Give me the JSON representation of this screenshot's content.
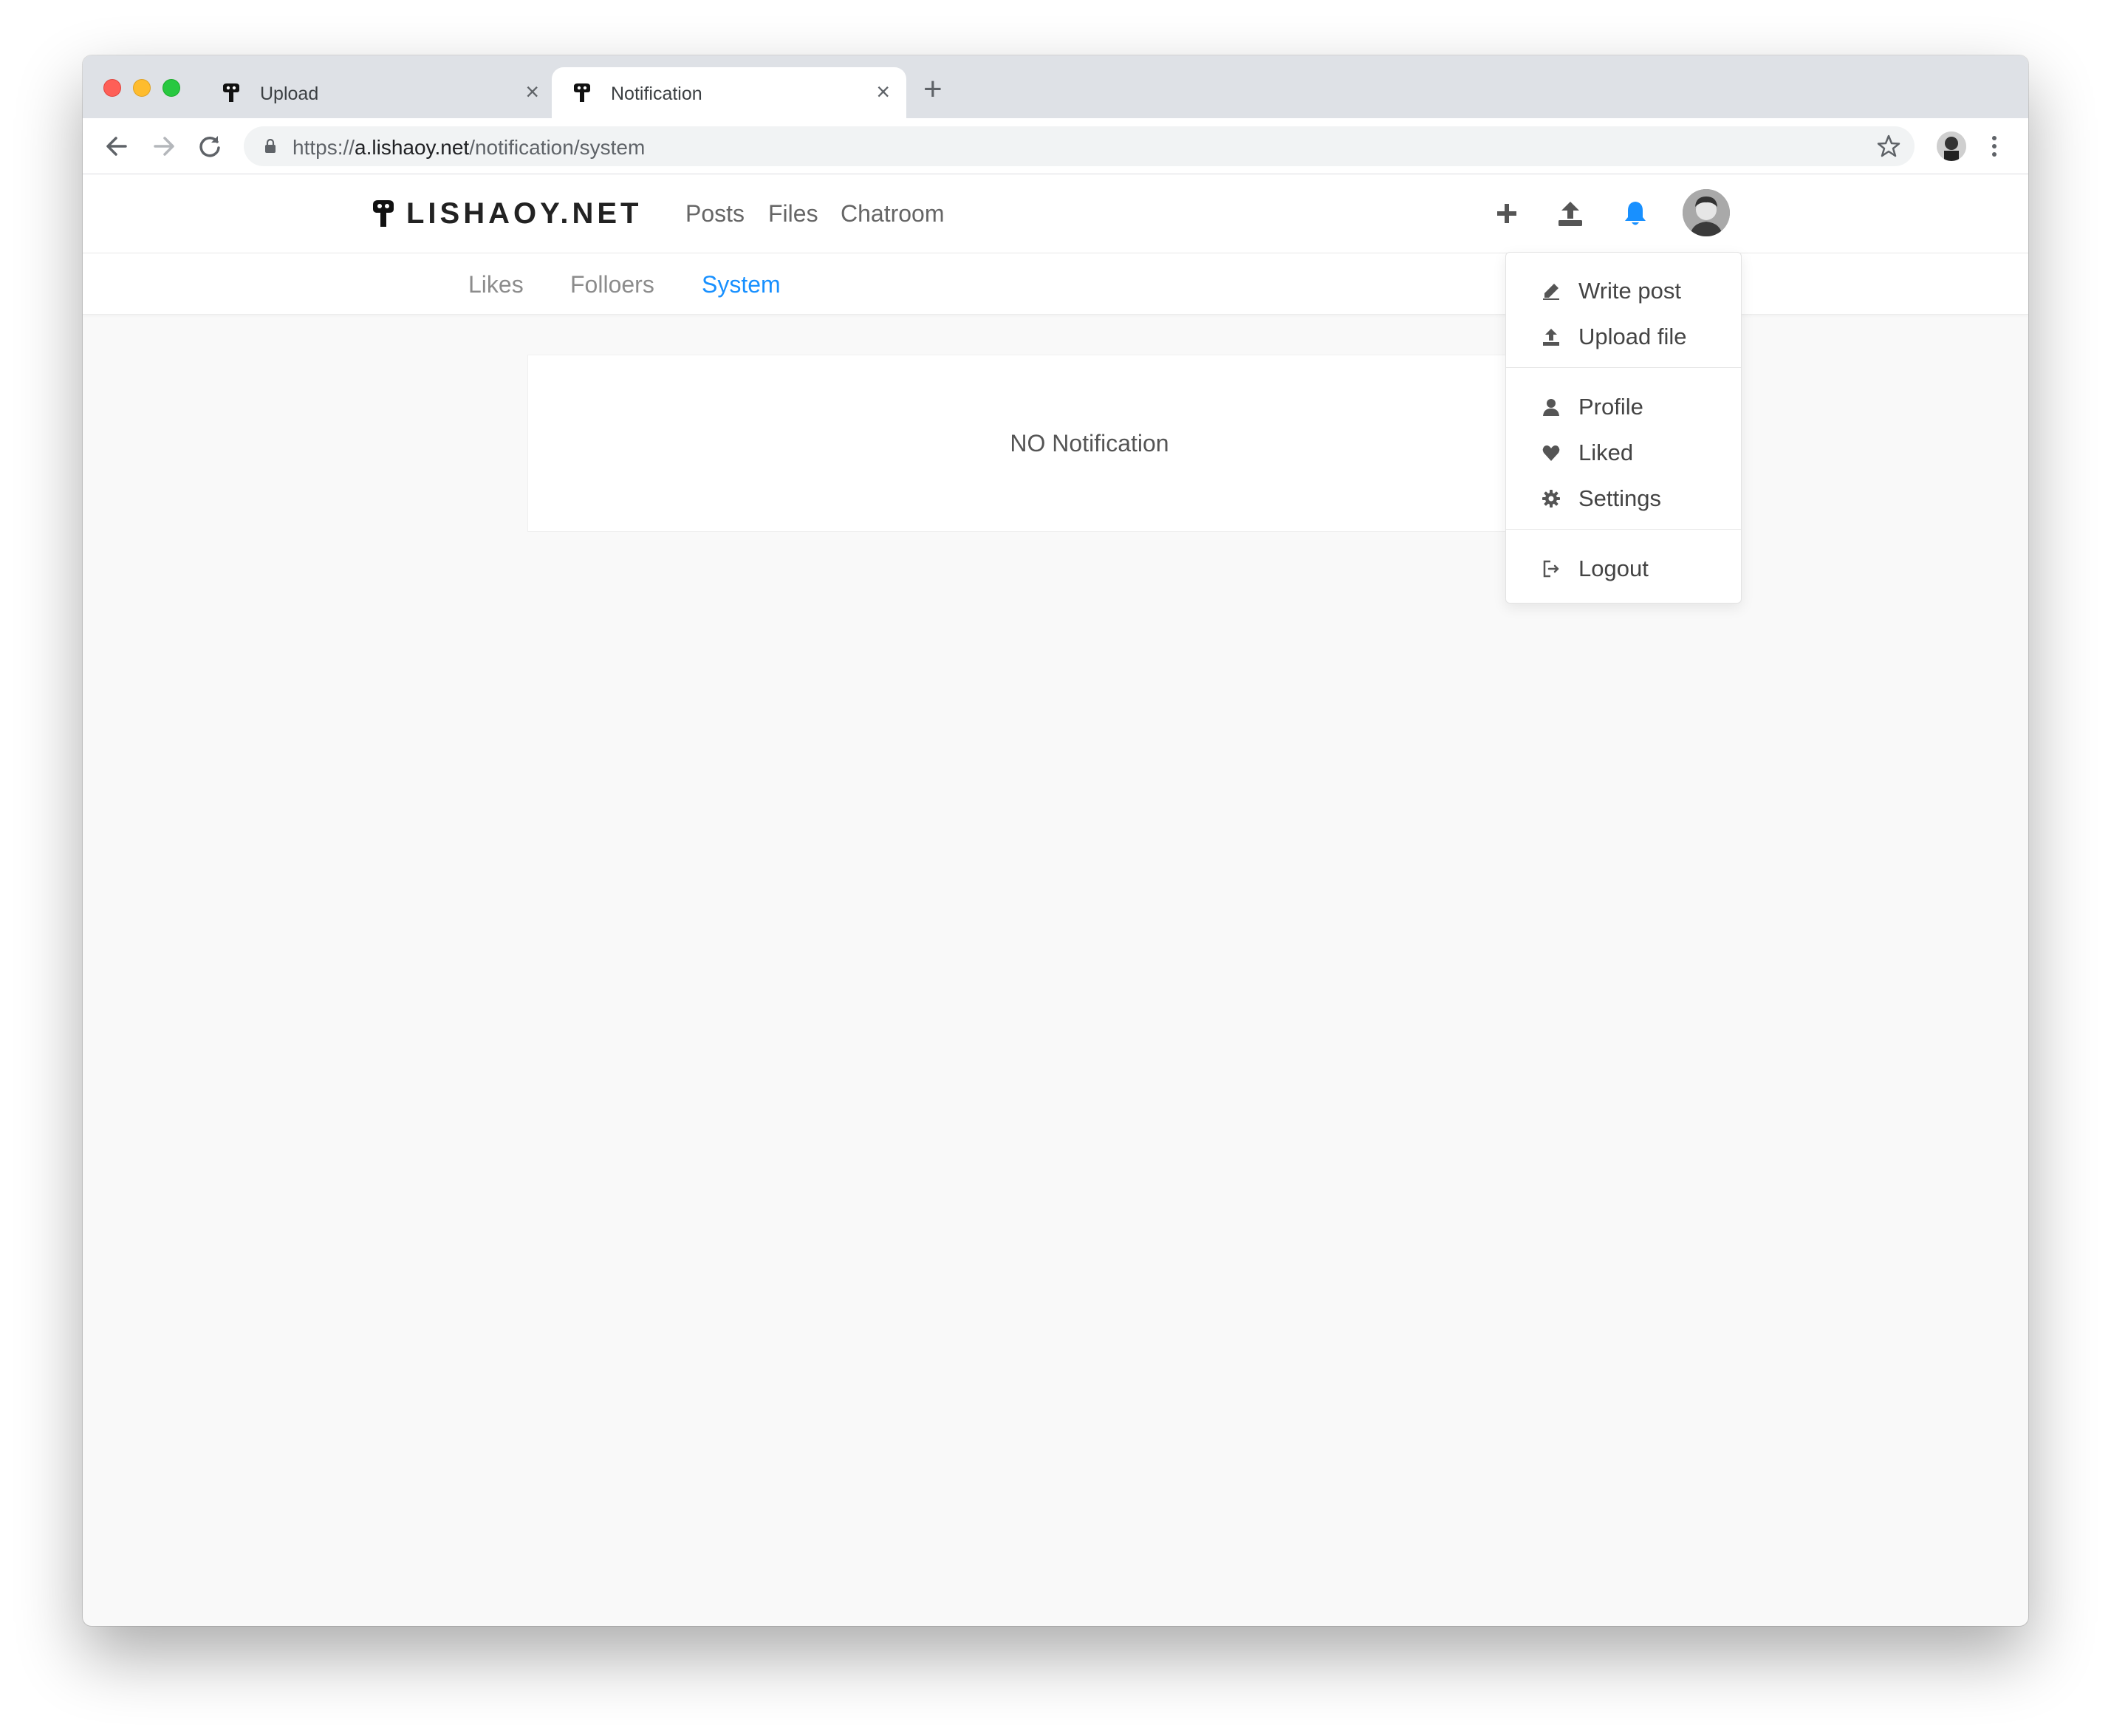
{
  "browser": {
    "tabs": [
      {
        "title": "Upload",
        "close": "×"
      },
      {
        "title": "Notification",
        "close": "×"
      }
    ],
    "new_tab": "+",
    "url_scheme": "https://",
    "url_host": "a.lishaoy.net",
    "url_path": "/notification/system"
  },
  "site": {
    "logo_text": "LISHAOY.NET",
    "nav": [
      "Posts",
      "Files",
      "Chatroom"
    ],
    "accent_color": "#1890ff"
  },
  "subnav": {
    "tabs": [
      "Likes",
      "Folloers",
      "System"
    ],
    "active": "System"
  },
  "main": {
    "empty_message": "NO Notification"
  },
  "user_menu": {
    "items": [
      {
        "label": "Write post",
        "icon": "pencil-icon"
      },
      {
        "label": "Upload file",
        "icon": "upload-icon"
      },
      {
        "label": "Profile",
        "icon": "user-icon"
      },
      {
        "label": "Liked",
        "icon": "heart-icon"
      },
      {
        "label": "Settings",
        "icon": "gear-icon"
      },
      {
        "label": "Logout",
        "icon": "logout-icon"
      }
    ]
  }
}
